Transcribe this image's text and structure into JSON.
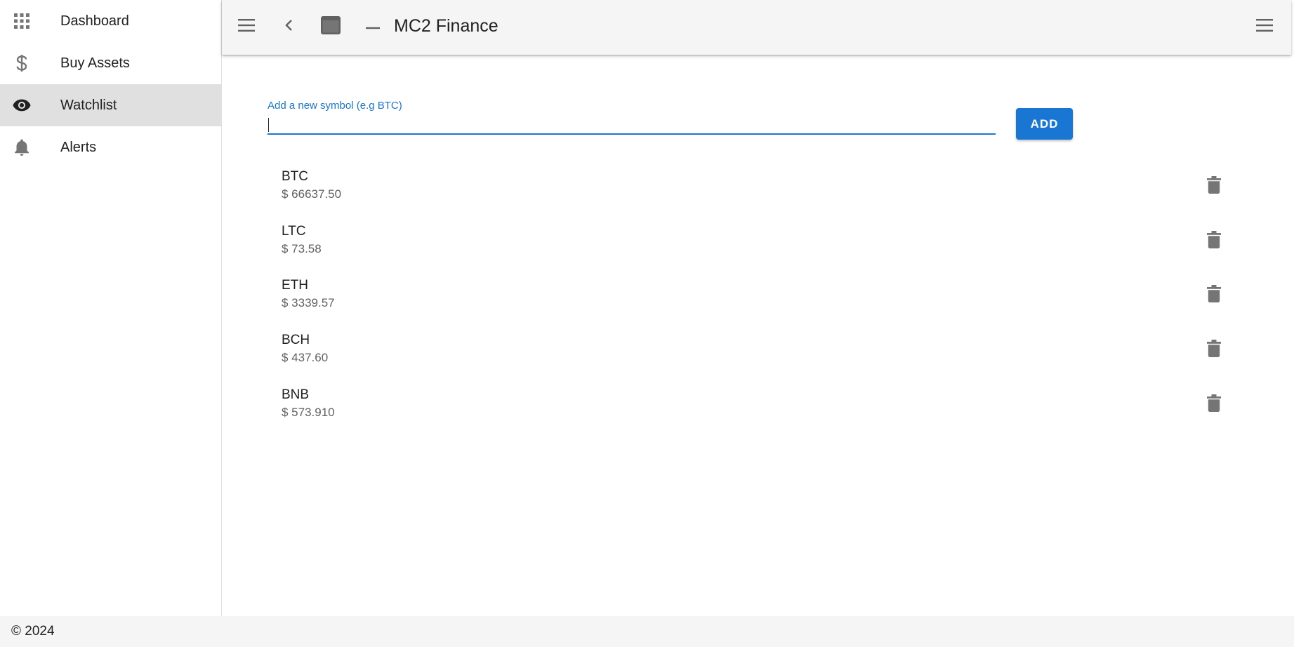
{
  "sidebar": {
    "items": [
      {
        "label": "Dashboard",
        "icon": "apps-grid-icon"
      },
      {
        "label": "Buy Assets",
        "icon": "dollar-icon"
      },
      {
        "label": "Watchlist",
        "icon": "eye-icon",
        "active": true
      },
      {
        "label": "Alerts",
        "icon": "bell-icon"
      }
    ]
  },
  "header": {
    "title": "MC2 Finance",
    "icons": [
      "menu-icon",
      "chevron-left-icon",
      "window-icon",
      "minimize-icon",
      "menu-icon"
    ]
  },
  "watchlist": {
    "input_label": "Add a new symbol (e.g BTC)",
    "input_value": "",
    "add_label": "ADD",
    "items": [
      {
        "symbol": "BTC",
        "price": "$ 66637.50"
      },
      {
        "symbol": "LTC",
        "price": "$ 73.58"
      },
      {
        "symbol": "ETH",
        "price": "$ 3339.57"
      },
      {
        "symbol": "BCH",
        "price": "$ 437.60"
      },
      {
        "symbol": "BNB",
        "price": "$ 573.910"
      }
    ]
  },
  "footer": {
    "text": "© 2024"
  },
  "colors": {
    "accent": "#1976d2",
    "sidebar_active_bg": "#e0e0e0",
    "topbar_bg": "#f5f5f5",
    "icon_gray": "#757575"
  }
}
